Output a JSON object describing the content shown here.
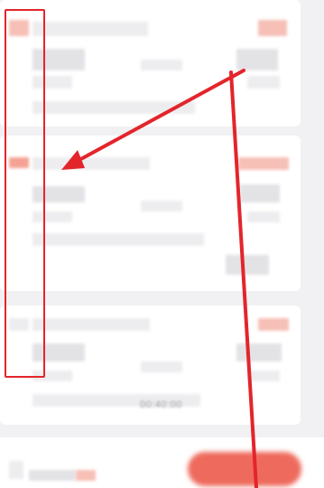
{
  "orders": [
    {
      "status": "",
      "time": ""
    },
    {
      "status": "",
      "time": ""
    },
    {
      "status": "",
      "time": "00:40:00"
    }
  ],
  "footer": {
    "action_label": ""
  },
  "annotation": {
    "box_color": "#e3252b",
    "arrow_color": "#e3252b"
  },
  "icons": {
    "arrow-icon": "red-annotation-arrow"
  }
}
